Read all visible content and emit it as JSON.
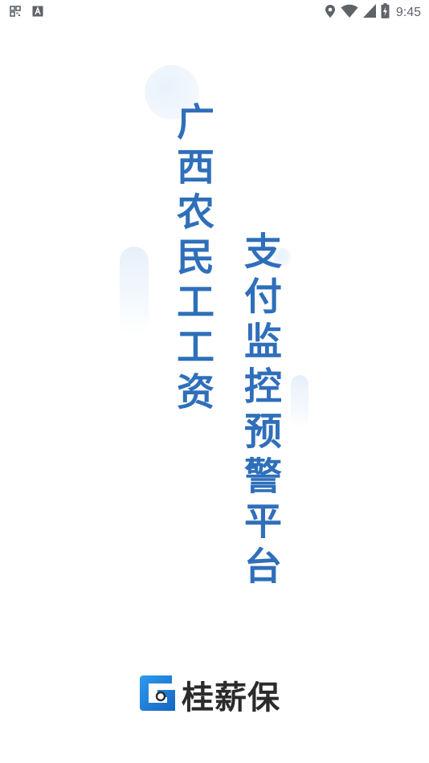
{
  "status_bar": {
    "time": "9:45",
    "left_icons": [
      "qr-grid-icon",
      "text-box-icon"
    ],
    "right_icons": [
      "location-icon",
      "wifi-icon",
      "signal-icon",
      "battery-icon"
    ]
  },
  "splash": {
    "line_one": "广西农民工工资",
    "line_two": "支付监控预警平台"
  },
  "brand": {
    "name": "桂薪保",
    "logo_icon": "g-logo-icon"
  },
  "colors": {
    "title_blue": "#2f6fba",
    "logo_blue": "#1a7bd6",
    "logo_dark": "#2b2b2b",
    "bubble": "#eaf3fb"
  }
}
